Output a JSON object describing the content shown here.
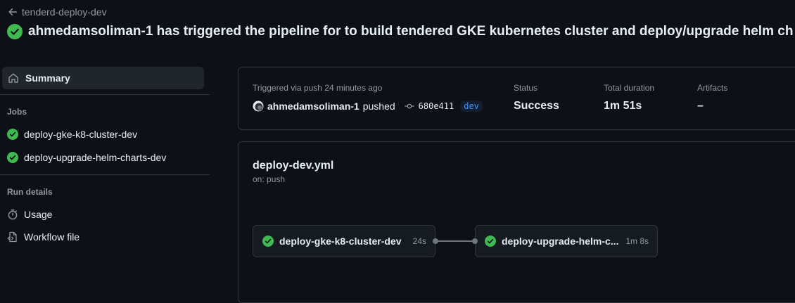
{
  "header": {
    "back_label": "tenderd-deploy-dev",
    "run_title": "ahmedamsoliman-1 has triggered the pipeline for to build tendered GKE kubernetes cluster and deploy/upgrade helm ch"
  },
  "sidebar": {
    "summary_label": "Summary",
    "jobs_heading": "Jobs",
    "jobs": [
      {
        "label": "deploy-gke-k8-cluster-dev"
      },
      {
        "label": "deploy-upgrade-helm-charts-dev"
      }
    ],
    "run_details_heading": "Run details",
    "run_details": [
      {
        "label": "Usage",
        "icon": "stopwatch-icon"
      },
      {
        "label": "Workflow file",
        "icon": "file-code-icon"
      }
    ]
  },
  "summary_card": {
    "trigger_text": "Triggered via push 24 minutes ago",
    "actor": "ahmedamsoliman-1",
    "action": "pushed",
    "commit_sha": "680e411",
    "branch": "dev",
    "status_label": "Status",
    "status_value": "Success",
    "duration_label": "Total duration",
    "duration_value": "1m 51s",
    "artifacts_label": "Artifacts",
    "artifacts_value": "–"
  },
  "workflow": {
    "file_name": "deploy-dev.yml",
    "trigger": "on: push",
    "jobs": [
      {
        "name": "deploy-gke-k8-cluster-dev",
        "duration": "24s"
      },
      {
        "name": "deploy-upgrade-helm-c...",
        "duration": "1m 8s"
      }
    ]
  },
  "colors": {
    "background": "#0d1117",
    "success": "#3fb950",
    "border": "#30363d",
    "muted_text": "#9198a1",
    "link": "#4493f8"
  }
}
